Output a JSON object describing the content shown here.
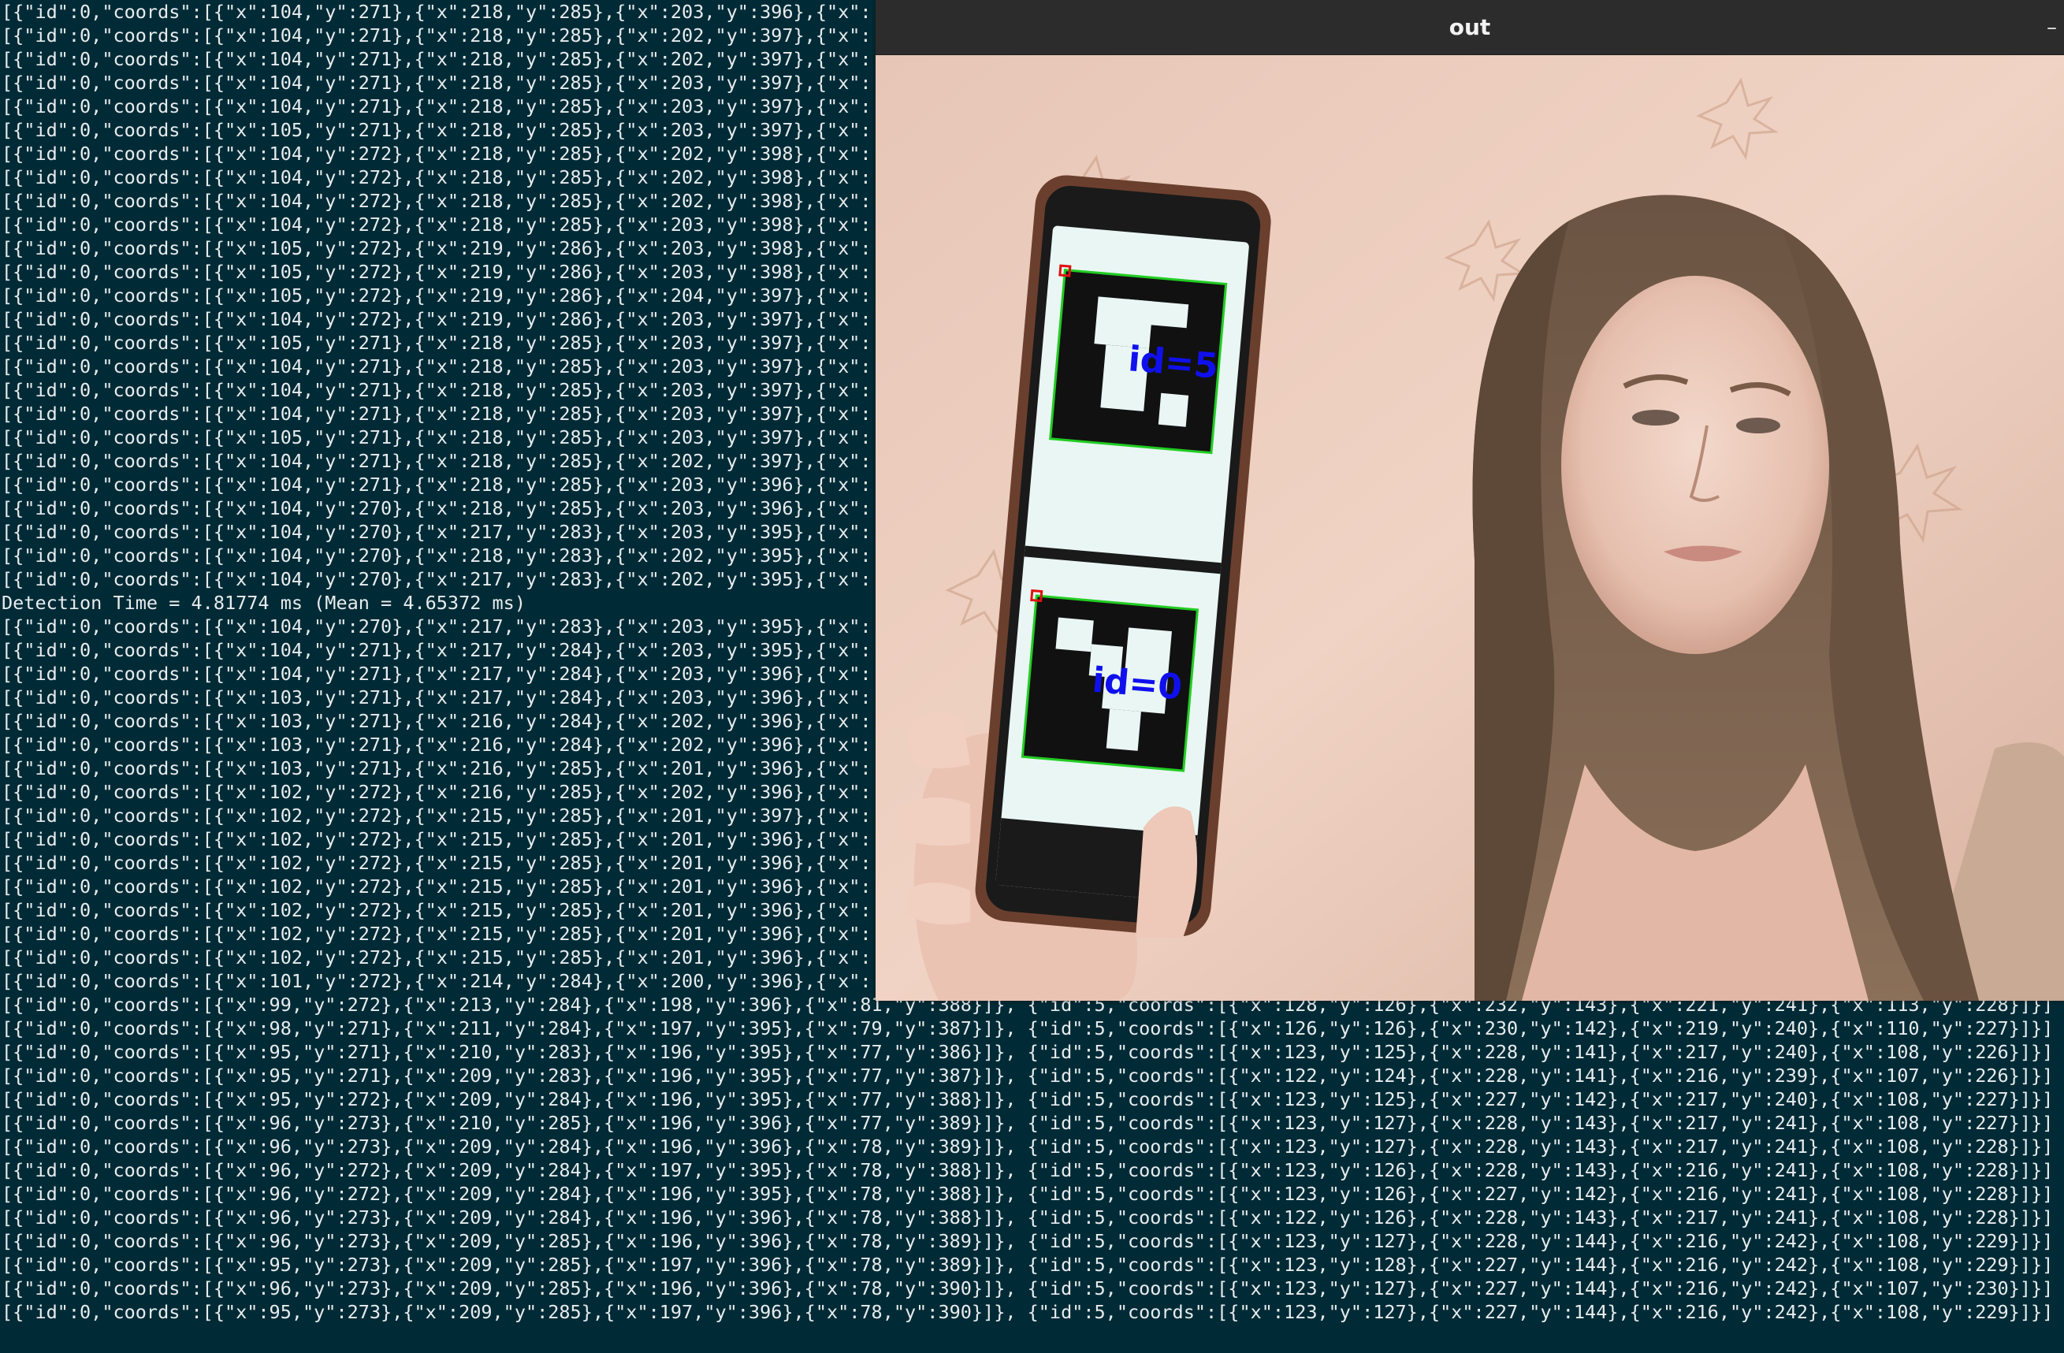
{
  "terminal": {
    "lines": [
      "[{\"id\":0,\"coords\":[{\"x\":104,\"y\":271},{\"x\":218,\"y\":285},{\"x\":203,\"y\":396},{\"x\":",
      "[{\"id\":0,\"coords\":[{\"x\":104,\"y\":271},{\"x\":218,\"y\":285},{\"x\":202,\"y\":397},{\"x\":",
      "[{\"id\":0,\"coords\":[{\"x\":104,\"y\":271},{\"x\":218,\"y\":285},{\"x\":202,\"y\":397},{\"x\":",
      "[{\"id\":0,\"coords\":[{\"x\":104,\"y\":271},{\"x\":218,\"y\":285},{\"x\":203,\"y\":397},{\"x\":",
      "[{\"id\":0,\"coords\":[{\"x\":104,\"y\":271},{\"x\":218,\"y\":285},{\"x\":203,\"y\":397},{\"x\":",
      "[{\"id\":0,\"coords\":[{\"x\":105,\"y\":271},{\"x\":218,\"y\":285},{\"x\":203,\"y\":397},{\"x\":",
      "[{\"id\":0,\"coords\":[{\"x\":104,\"y\":272},{\"x\":218,\"y\":285},{\"x\":202,\"y\":398},{\"x\":",
      "[{\"id\":0,\"coords\":[{\"x\":104,\"y\":272},{\"x\":218,\"y\":285},{\"x\":202,\"y\":398},{\"x\":",
      "[{\"id\":0,\"coords\":[{\"x\":104,\"y\":272},{\"x\":218,\"y\":285},{\"x\":202,\"y\":398},{\"x\":",
      "[{\"id\":0,\"coords\":[{\"x\":104,\"y\":272},{\"x\":218,\"y\":285},{\"x\":203,\"y\":398},{\"x\":",
      "[{\"id\":0,\"coords\":[{\"x\":105,\"y\":272},{\"x\":219,\"y\":286},{\"x\":203,\"y\":398},{\"x\":",
      "[{\"id\":0,\"coords\":[{\"x\":105,\"y\":272},{\"x\":219,\"y\":286},{\"x\":203,\"y\":398},{\"x\":",
      "[{\"id\":0,\"coords\":[{\"x\":105,\"y\":272},{\"x\":219,\"y\":286},{\"x\":204,\"y\":397},{\"x\":",
      "[{\"id\":0,\"coords\":[{\"x\":104,\"y\":272},{\"x\":219,\"y\":286},{\"x\":203,\"y\":397},{\"x\":",
      "[{\"id\":0,\"coords\":[{\"x\":105,\"y\":271},{\"x\":218,\"y\":285},{\"x\":203,\"y\":397},{\"x\":",
      "[{\"id\":0,\"coords\":[{\"x\":104,\"y\":271},{\"x\":218,\"y\":285},{\"x\":203,\"y\":397},{\"x\":",
      "[{\"id\":0,\"coords\":[{\"x\":104,\"y\":271},{\"x\":218,\"y\":285},{\"x\":203,\"y\":397},{\"x\":",
      "[{\"id\":0,\"coords\":[{\"x\":104,\"y\":271},{\"x\":218,\"y\":285},{\"x\":203,\"y\":397},{\"x\":",
      "[{\"id\":0,\"coords\":[{\"x\":105,\"y\":271},{\"x\":218,\"y\":285},{\"x\":203,\"y\":397},{\"x\":",
      "[{\"id\":0,\"coords\":[{\"x\":104,\"y\":271},{\"x\":218,\"y\":285},{\"x\":202,\"y\":397},{\"x\":",
      "[{\"id\":0,\"coords\":[{\"x\":104,\"y\":271},{\"x\":218,\"y\":285},{\"x\":203,\"y\":396},{\"x\":",
      "[{\"id\":0,\"coords\":[{\"x\":104,\"y\":270},{\"x\":218,\"y\":285},{\"x\":203,\"y\":396},{\"x\":",
      "[{\"id\":0,\"coords\":[{\"x\":104,\"y\":270},{\"x\":217,\"y\":283},{\"x\":203,\"y\":395},{\"x\":",
      "[{\"id\":0,\"coords\":[{\"x\":104,\"y\":270},{\"x\":218,\"y\":283},{\"x\":202,\"y\":395},{\"x\":",
      "[{\"id\":0,\"coords\":[{\"x\":104,\"y\":270},{\"x\":217,\"y\":283},{\"x\":202,\"y\":395},{\"x\":",
      "Detection Time = 4.81774 ms (Mean = 4.65372 ms)",
      "[{\"id\":0,\"coords\":[{\"x\":104,\"y\":270},{\"x\":217,\"y\":283},{\"x\":203,\"y\":395},{\"x\":",
      "[{\"id\":0,\"coords\":[{\"x\":104,\"y\":271},{\"x\":217,\"y\":284},{\"x\":203,\"y\":395},{\"x\":",
      "[{\"id\":0,\"coords\":[{\"x\":104,\"y\":271},{\"x\":217,\"y\":284},{\"x\":203,\"y\":396},{\"x\":",
      "[{\"id\":0,\"coords\":[{\"x\":103,\"y\":271},{\"x\":217,\"y\":284},{\"x\":203,\"y\":396},{\"x\":",
      "[{\"id\":0,\"coords\":[{\"x\":103,\"y\":271},{\"x\":216,\"y\":284},{\"x\":202,\"y\":396},{\"x\":",
      "[{\"id\":0,\"coords\":[{\"x\":103,\"y\":271},{\"x\":216,\"y\":284},{\"x\":202,\"y\":396},{\"x\":",
      "[{\"id\":0,\"coords\":[{\"x\":103,\"y\":271},{\"x\":216,\"y\":285},{\"x\":201,\"y\":396},{\"x\":",
      "[{\"id\":0,\"coords\":[{\"x\":102,\"y\":272},{\"x\":216,\"y\":285},{\"x\":202,\"y\":396},{\"x\":",
      "[{\"id\":0,\"coords\":[{\"x\":102,\"y\":272},{\"x\":215,\"y\":285},{\"x\":201,\"y\":397},{\"x\":",
      "[{\"id\":0,\"coords\":[{\"x\":102,\"y\":272},{\"x\":215,\"y\":285},{\"x\":201,\"y\":396},{\"x\":",
      "[{\"id\":0,\"coords\":[{\"x\":102,\"y\":272},{\"x\":215,\"y\":285},{\"x\":201,\"y\":396},{\"x\":",
      "[{\"id\":0,\"coords\":[{\"x\":102,\"y\":272},{\"x\":215,\"y\":285},{\"x\":201,\"y\":396},{\"x\":",
      "[{\"id\":0,\"coords\":[{\"x\":102,\"y\":272},{\"x\":215,\"y\":285},{\"x\":201,\"y\":396},{\"x\":",
      "[{\"id\":0,\"coords\":[{\"x\":102,\"y\":272},{\"x\":215,\"y\":285},{\"x\":201,\"y\":396},{\"x\":",
      "[{\"id\":0,\"coords\":[{\"x\":102,\"y\":272},{\"x\":215,\"y\":285},{\"x\":201,\"y\":396},{\"x\":",
      "[{\"id\":0,\"coords\":[{\"x\":101,\"y\":272},{\"x\":214,\"y\":284},{\"x\":200,\"y\":396},{\"x\":",
      "[{\"id\":0,\"coords\":[{\"x\":99,\"y\":272},{\"x\":213,\"y\":284},{\"x\":198,\"y\":396},{\"x\":81,\"y\":388}]}, {\"id\":5,\"coords\":[{\"x\":128,\"y\":126},{\"x\":232,\"y\":143},{\"x\":221,\"y\":241},{\"x\":113,\"y\":228}]}]",
      "[{\"id\":0,\"coords\":[{\"x\":98,\"y\":271},{\"x\":211,\"y\":284},{\"x\":197,\"y\":395},{\"x\":79,\"y\":387}]}, {\"id\":5,\"coords\":[{\"x\":126,\"y\":126},{\"x\":230,\"y\":142},{\"x\":219,\"y\":240},{\"x\":110,\"y\":227}]}]",
      "[{\"id\":0,\"coords\":[{\"x\":95,\"y\":271},{\"x\":210,\"y\":283},{\"x\":196,\"y\":395},{\"x\":77,\"y\":386}]}, {\"id\":5,\"coords\":[{\"x\":123,\"y\":125},{\"x\":228,\"y\":141},{\"x\":217,\"y\":240},{\"x\":108,\"y\":226}]}]",
      "[{\"id\":0,\"coords\":[{\"x\":95,\"y\":271},{\"x\":209,\"y\":283},{\"x\":196,\"y\":395},{\"x\":77,\"y\":387}]}, {\"id\":5,\"coords\":[{\"x\":122,\"y\":124},{\"x\":228,\"y\":141},{\"x\":216,\"y\":239},{\"x\":107,\"y\":226}]}]",
      "[{\"id\":0,\"coords\":[{\"x\":95,\"y\":272},{\"x\":209,\"y\":284},{\"x\":196,\"y\":395},{\"x\":77,\"y\":388}]}, {\"id\":5,\"coords\":[{\"x\":123,\"y\":125},{\"x\":227,\"y\":142},{\"x\":217,\"y\":240},{\"x\":108,\"y\":227}]}]",
      "[{\"id\":0,\"coords\":[{\"x\":96,\"y\":273},{\"x\":210,\"y\":285},{\"x\":196,\"y\":396},{\"x\":77,\"y\":389}]}, {\"id\":5,\"coords\":[{\"x\":123,\"y\":127},{\"x\":228,\"y\":143},{\"x\":217,\"y\":241},{\"x\":108,\"y\":227}]}]",
      "[{\"id\":0,\"coords\":[{\"x\":96,\"y\":273},{\"x\":209,\"y\":284},{\"x\":196,\"y\":396},{\"x\":78,\"y\":389}]}, {\"id\":5,\"coords\":[{\"x\":123,\"y\":127},{\"x\":228,\"y\":143},{\"x\":217,\"y\":241},{\"x\":108,\"y\":228}]}]",
      "[{\"id\":0,\"coords\":[{\"x\":96,\"y\":272},{\"x\":209,\"y\":284},{\"x\":197,\"y\":395},{\"x\":78,\"y\":388}]}, {\"id\":5,\"coords\":[{\"x\":123,\"y\":126},{\"x\":228,\"y\":143},{\"x\":216,\"y\":241},{\"x\":108,\"y\":228}]}]",
      "[{\"id\":0,\"coords\":[{\"x\":96,\"y\":272},{\"x\":209,\"y\":284},{\"x\":196,\"y\":395},{\"x\":78,\"y\":388}]}, {\"id\":5,\"coords\":[{\"x\":123,\"y\":126},{\"x\":227,\"y\":142},{\"x\":216,\"y\":241},{\"x\":108,\"y\":228}]}]",
      "[{\"id\":0,\"coords\":[{\"x\":96,\"y\":273},{\"x\":209,\"y\":284},{\"x\":196,\"y\":396},{\"x\":78,\"y\":388}]}, {\"id\":5,\"coords\":[{\"x\":122,\"y\":126},{\"x\":228,\"y\":143},{\"x\":217,\"y\":241},{\"x\":108,\"y\":228}]}]",
      "[{\"id\":0,\"coords\":[{\"x\":96,\"y\":273},{\"x\":209,\"y\":285},{\"x\":196,\"y\":396},{\"x\":78,\"y\":389}]}, {\"id\":5,\"coords\":[{\"x\":123,\"y\":127},{\"x\":228,\"y\":144},{\"x\":216,\"y\":242},{\"x\":108,\"y\":229}]}]",
      "[{\"id\":0,\"coords\":[{\"x\":95,\"y\":273},{\"x\":209,\"y\":285},{\"x\":197,\"y\":396},{\"x\":78,\"y\":389}]}, {\"id\":5,\"coords\":[{\"x\":123,\"y\":128},{\"x\":227,\"y\":144},{\"x\":216,\"y\":242},{\"x\":108,\"y\":229}]}]",
      "[{\"id\":0,\"coords\":[{\"x\":96,\"y\":273},{\"x\":209,\"y\":285},{\"x\":196,\"y\":396},{\"x\":78,\"y\":390}]}, {\"id\":5,\"coords\":[{\"x\":123,\"y\":127},{\"x\":227,\"y\":144},{\"x\":216,\"y\":242},{\"x\":107,\"y\":230}]}]",
      "[{\"id\":0,\"coords\":[{\"x\":95,\"y\":273},{\"x\":209,\"y\":285},{\"x\":197,\"y\":396},{\"x\":78,\"y\":390}]}, {\"id\":5,\"coords\":[{\"x\":123,\"y\":127},{\"x\":227,\"y\":144},{\"x\":216,\"y\":242},{\"x\":108,\"y\":229}]}]"
    ]
  },
  "window": {
    "title": "out",
    "minimize_glyph": "–"
  },
  "markers": {
    "top_label": "id=5",
    "bottom_label": "id=0"
  },
  "colors": {
    "terminal_bg": "#002b36",
    "terminal_text": "#e8ecee",
    "marker_outline": "#22cc22",
    "marker_label": "#1010ee",
    "corner_marker": "#e01010"
  },
  "icons": {
    "minimize": "minimize-icon"
  }
}
